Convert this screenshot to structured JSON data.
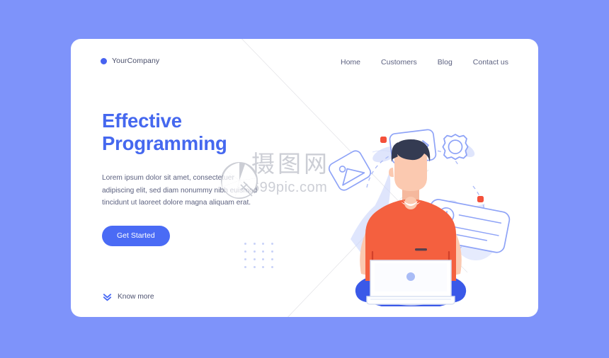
{
  "page": {
    "background_color": "#7e93fa",
    "card_background": "#ffffff"
  },
  "header": {
    "brand": {
      "name": "YourCompany",
      "dot_icon": "brand-dot-icon",
      "dot_color": "#4762f0"
    },
    "nav_items": [
      {
        "label": "Home"
      },
      {
        "label": "Customers"
      },
      {
        "label": "Blog"
      },
      {
        "label": "Contact us"
      }
    ]
  },
  "hero": {
    "title_line1": "Effective",
    "title_line2": "Programming",
    "title_color": "#4568ef",
    "paragraph": "Lorem ipsum dolor sit amet, consectetuer adipiscing elit, sed diam nonummy nibh euismod tincidunt ut laoreet dolore magna aliquam erat.",
    "cta_label": "Get Started",
    "cta_color": "#4a6bf5",
    "know_more_label": "Know more",
    "know_more_icon": "double-chevron-down-icon"
  },
  "illustration": {
    "name": "developer-with-laptop-illustration",
    "colors": {
      "shirt": "#f4603f",
      "skin": "#fbc9b0",
      "hair": "#343b52",
      "pants": "#3a59e8",
      "laptop": "#ffffff",
      "outline_blue": "#8ea3f7",
      "leaf_blue": "#ccd6fb",
      "accent_red": "#f4503a"
    },
    "floating_icons": [
      {
        "name": "code-tag-icon",
        "label": "</>"
      },
      {
        "name": "image-photo-icon",
        "label": ""
      },
      {
        "name": "gear-settings-icon",
        "label": ""
      },
      {
        "name": "clock-card-icon",
        "label": ""
      }
    ],
    "accent_dots": 2
  },
  "watermark": {
    "chinese_text": "摄图网",
    "site_text": "699pic.com",
    "aperture_icon": "camera-aperture-icon"
  }
}
